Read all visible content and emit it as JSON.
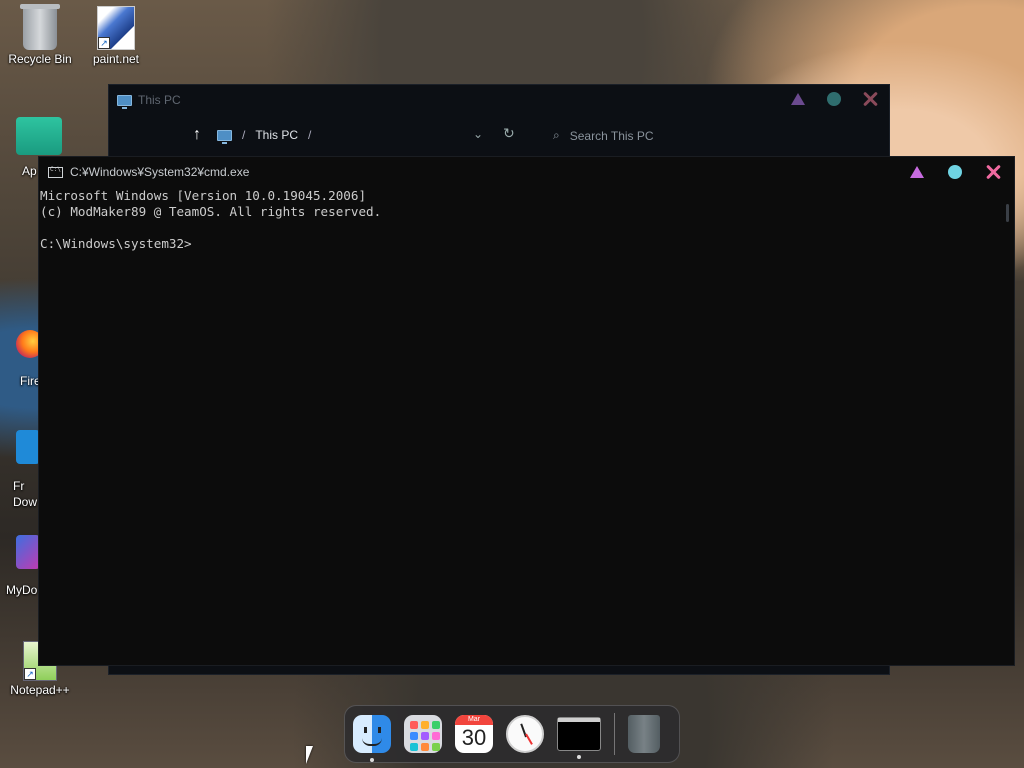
{
  "desktop": {
    "icons": [
      {
        "label": "Recycle Bin"
      },
      {
        "label": "paint.net"
      },
      {
        "label": "Ap The"
      },
      {
        "label": "Fire"
      },
      {
        "label": "Fr Dow"
      },
      {
        "label": "MyDo"
      },
      {
        "label": "Notepad++"
      }
    ]
  },
  "explorer": {
    "title": "This PC",
    "breadcrumb_item": "This PC",
    "breadcrumb_sep": "/",
    "search_placeholder": "Search This PC"
  },
  "cmd": {
    "title": "C:¥Windows¥System32¥cmd.exe",
    "console_text": "Microsoft Windows [Version 10.0.19045.2006]\n(c) ModMaker89 @ TeamOS. All rights reserved.\n\nC:\\Windows\\system32>"
  },
  "dock": {
    "calendar_month": "Mar",
    "calendar_day": "30",
    "items": [
      "finder",
      "launchpad",
      "calendar",
      "clock",
      "terminal",
      "trash"
    ]
  },
  "colors": {
    "cmd_minimize": "#c86be0",
    "cmd_maximize": "#6fd3e2",
    "cmd_close": "#f06aa0",
    "console_text": "#cccccc",
    "console_bg": "#0c0c0c"
  }
}
